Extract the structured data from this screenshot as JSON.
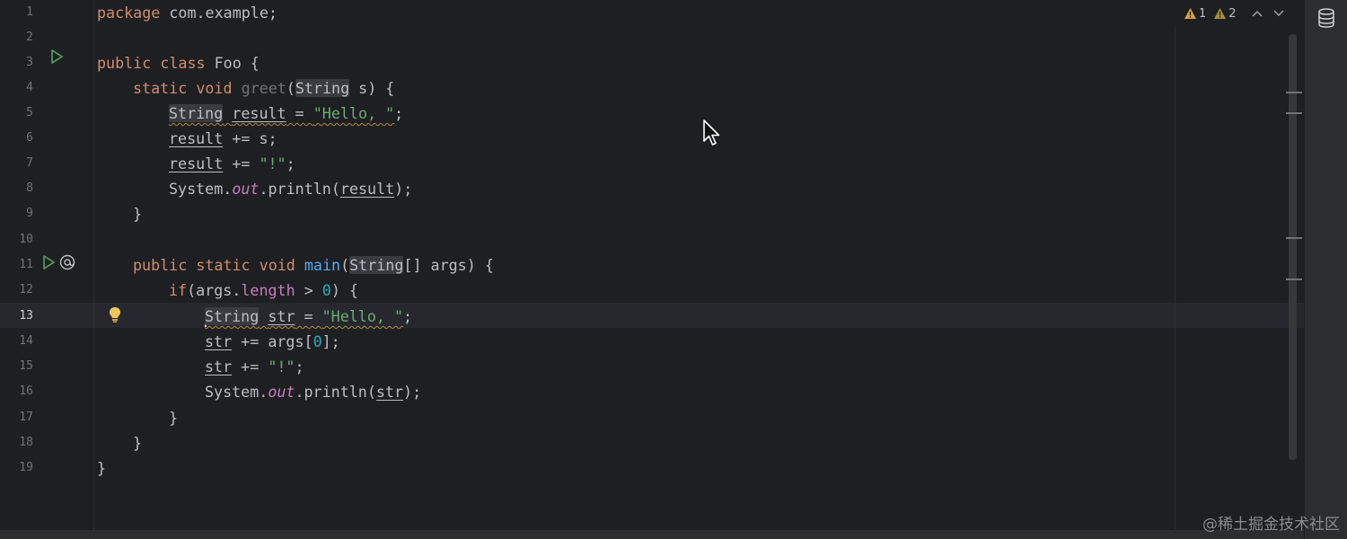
{
  "editor": {
    "line_numbers": [
      "1",
      "2",
      "3",
      "4",
      "5",
      "6",
      "7",
      "8",
      "9",
      "10",
      "11",
      "12",
      "13",
      "14",
      "15",
      "16",
      "17",
      "18",
      "19"
    ],
    "active_line": "13",
    "code": {
      "l1": [
        "package",
        " com.example;"
      ],
      "l3": [
        "public",
        " ",
        "class",
        " Foo {"
      ],
      "l4": [
        "static",
        " ",
        "void",
        " ",
        "greet",
        "(",
        "String",
        " s) {"
      ],
      "l5": [
        "String",
        " ",
        "result",
        " = ",
        "\"Hello, \"",
        ";"
      ],
      "l6": [
        "result",
        " += s;"
      ],
      "l7": [
        "result",
        " += ",
        "\"!\"",
        ";"
      ],
      "l8": [
        "System.",
        "out",
        ".println(",
        "result",
        ");"
      ],
      "l9": [
        "}"
      ],
      "l11": [
        "public",
        " ",
        "static",
        " ",
        "void",
        " ",
        "main",
        "(",
        "String",
        "[] args) {"
      ],
      "l12": [
        "if",
        "(args.",
        "length",
        " > ",
        "0",
        ") {"
      ],
      "l13": [
        "String",
        " ",
        "str",
        " = ",
        "\"Hello, \"",
        ";"
      ],
      "l14": [
        "str",
        " += args[",
        "0",
        "];"
      ],
      "l15": [
        "str",
        " += ",
        "\"!\"",
        ";"
      ],
      "l16": [
        "System.",
        "out",
        ".println(",
        "str",
        ");"
      ],
      "l17": [
        "}"
      ],
      "l18": [
        "}"
      ],
      "l19": [
        "}"
      ]
    }
  },
  "gutter_icons": {
    "run_class": "run-icon",
    "run_main": "run-icon",
    "implements": "at-icon",
    "intention": "lightbulb-icon"
  },
  "inspections": {
    "errors_count": "1",
    "warnings_count": "2"
  },
  "watermark": "@稀土掘金技术社区",
  "colors": {
    "background": "#1e1f22",
    "keyword": "#cf8e6d",
    "string": "#6aab73",
    "number": "#2aacb8",
    "method_decl": "#56a8f5",
    "static_field": "#c77dbb",
    "default_text": "#bcbec4"
  }
}
